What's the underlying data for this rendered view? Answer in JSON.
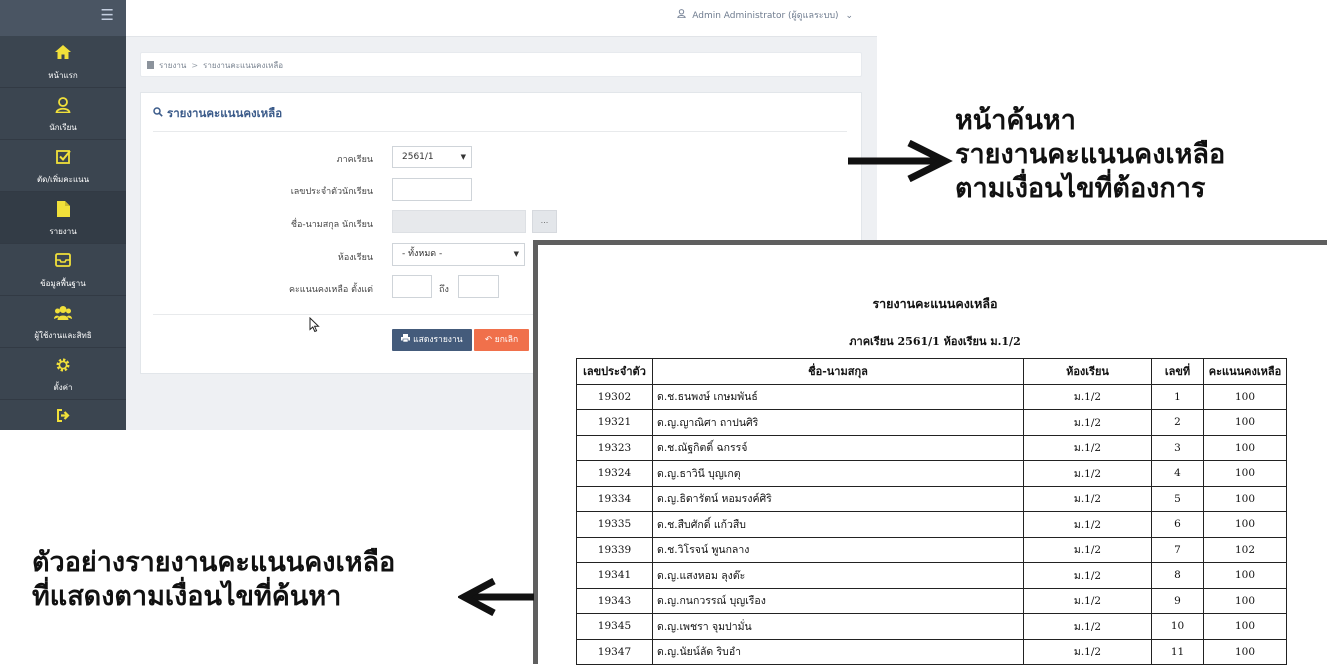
{
  "sidebar": {
    "items": [
      {
        "icon": "home-icon",
        "label": "หน้าแรก"
      },
      {
        "icon": "student-icon",
        "label": "นักเรียน"
      },
      {
        "icon": "check-square-icon",
        "label": "ตัด/เพิ่มคะแนน"
      },
      {
        "icon": "file-icon",
        "label": "รายงาน"
      },
      {
        "icon": "inbox-icon",
        "label": "ข้อมูลพื้นฐาน"
      },
      {
        "icon": "users-icon",
        "label": "ผู้ใช้งานและสิทธิ"
      },
      {
        "icon": "gear-icon",
        "label": "ตั้งค่า"
      },
      {
        "icon": "logout-icon",
        "label": ""
      }
    ]
  },
  "topbar": {
    "user": "Admin Administrator (ผู้ดูแลระบบ)"
  },
  "breadcrumb": [
    "รายงาน",
    "รายงานคะแนนคงเหลือ"
  ],
  "panel": {
    "title": "รายงานคะแนนคงเหลือ"
  },
  "form": {
    "semester_label": "ภาคเรียน",
    "semester_value": "2561/1",
    "student_id_label": "เลขประจำตัวนักเรียน",
    "student_id_value": "",
    "student_name_label": "ชื่อ-นามสกุล นักเรียน",
    "student_name_value": "",
    "browse_label": "...",
    "classroom_label": "ห้องเรียน",
    "classroom_value": "- ทั้งหมด -",
    "score_label": "คะแนนคงเหลือ ตั้งแต่",
    "score_from": "",
    "to_label": "ถึง",
    "score_to": ""
  },
  "buttons": {
    "show": "แสดงรายงาน",
    "cancel": "ยกเลิก"
  },
  "report": {
    "title": "รายงานคะแนนคงเหลือ",
    "subtitle": "ภาคเรียน 2561/1 ห้องเรียน ม.1/2",
    "columns": [
      "เลขประจำตัว",
      "ชื่อ-นามสกุล",
      "ห้องเรียน",
      "เลขที่",
      "คะแนนคงเหลือ"
    ],
    "rows": [
      [
        "19302",
        "ด.ช.ธนพงษ์   เกษมพันธ์",
        "ม.1/2",
        "1",
        "100"
      ],
      [
        "19321",
        "ด.ญ.ญาณิศา   ถาปนศิริ",
        "ม.1/2",
        "2",
        "100"
      ],
      [
        "19323",
        "ด.ช.ณัฐกิตติ์   ฉกรรจ์",
        "ม.1/2",
        "3",
        "100"
      ],
      [
        "19324",
        "ด.ญ.ธาวินี   บุญเกตุ",
        "ม.1/2",
        "4",
        "100"
      ],
      [
        "19334",
        "ด.ญ.ธิดารัตน์   หอมรงค์ศิริ",
        "ม.1/2",
        "5",
        "100"
      ],
      [
        "19335",
        "ด.ช.สืบศักดิ์   แก้วสืบ",
        "ม.1/2",
        "6",
        "100"
      ],
      [
        "19339",
        "ด.ช.วิโรจน์ พูนกลาง",
        "ม.1/2",
        "7",
        "102"
      ],
      [
        "19341",
        "ด.ญ.แสงหอม   ลุงต๊ะ",
        "ม.1/2",
        "8",
        "100"
      ],
      [
        "19343",
        "ด.ญ.กนกวรรณ์   บุญเรือง",
        "ม.1/2",
        "9",
        "100"
      ],
      [
        "19345",
        "ด.ญ.เพชรา   จุมปามั่น",
        "ม.1/2",
        "10",
        "100"
      ],
      [
        "19347",
        "ด.ญ.นัยน์ลัด   ริบอำ",
        "ม.1/2",
        "11",
        "100"
      ]
    ]
  },
  "annotations": {
    "search_page": [
      "หน้าค้นหา",
      "รายงานคะแนนคงเหลือ",
      "ตามเงื่อนไขที่ต้องการ"
    ],
    "report_example": [
      "ตัวอย่างรายงานคะแนนคงเหลือ",
      "ที่แสดงตามเงื่อนไขที่ค้นหา"
    ]
  }
}
